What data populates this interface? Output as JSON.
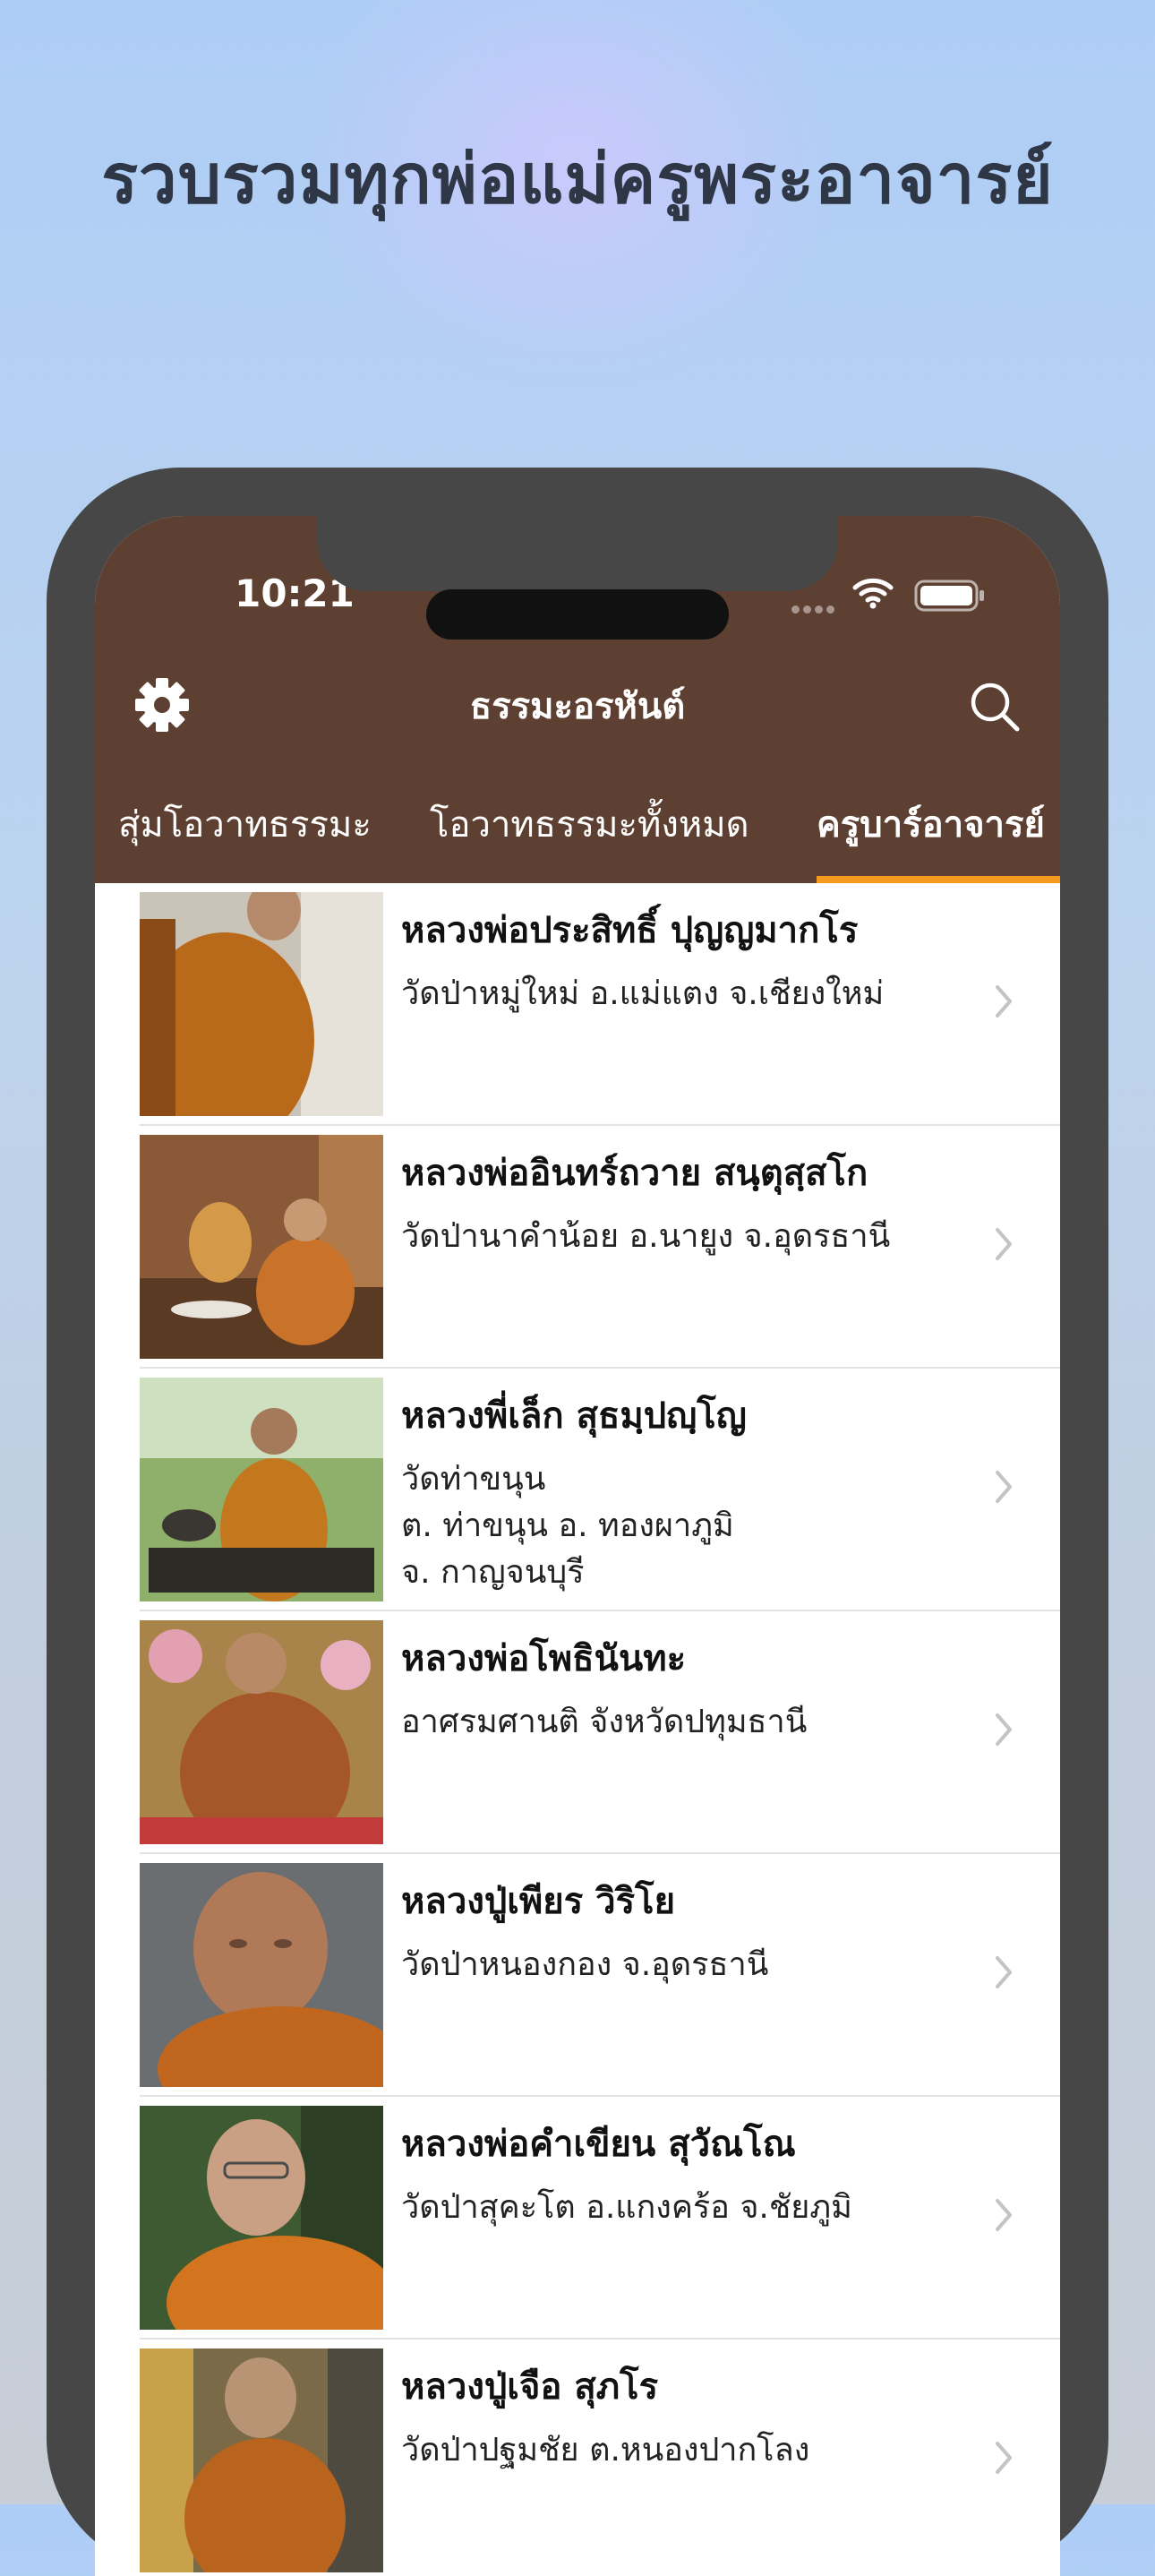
{
  "headline": "รวบรวมทุกพ่อแม่ครูพระอาจารย์",
  "status_bar": {
    "time": "10:21"
  },
  "app": {
    "title": "ธรรมะอรหันต์",
    "tabs": [
      {
        "label": "สุ่มโอวาทธรรมะ",
        "active": false
      },
      {
        "label": "โอวาทธรรมะทั้งหมด",
        "active": false
      },
      {
        "label": "ครูบาร์อาจารย์",
        "active": true
      }
    ]
  },
  "teachers": [
    {
      "name": "หลวงพ่อประสิทธิ์ ปุญญมากโร",
      "description": "วัดป่าหมู่ใหม่ อ.แม่แตง จ.เชียงใหม่"
    },
    {
      "name": "หลวงพ่ออินทร์ถวาย สนฺตุสฺสโก",
      "description": "วัดป่านาคำน้อย อ.นายูง จ.อุดรธานี"
    },
    {
      "name": "หลวงพี่เล็ก สุธมฺปญฺโญ",
      "description": "วัดท่าขนุน\nต. ท่าขนุน อ. ทองผาภูมิ\nจ. กาญจนบุรี"
    },
    {
      "name": "หลวงพ่อโพธินันทะ",
      "description": "อาศรมศานติ จังหวัดปทุมธานี"
    },
    {
      "name": "หลวงปู่เพียร วิริโย",
      "description": "วัดป่าหนองกอง จ.อุดรธานี"
    },
    {
      "name": "หลวงพ่อคำเขียน สุวัณโณ",
      "description": "วัดป่าสุคะโต อ.แกงคร้อ จ.ชัยภูมิ"
    },
    {
      "name": "หลวงปู่เจือ สุภโร",
      "description": "วัดป่าปฐมชัย ต.หนองปากโลง"
    }
  ],
  "colors": {
    "header_bg": "#5e4032",
    "tab_indicator": "#f59a1f",
    "frame": "#474747"
  },
  "icons": {
    "settings": "gear-icon",
    "search": "search-icon",
    "row_chevron": "chevron-right-icon"
  }
}
